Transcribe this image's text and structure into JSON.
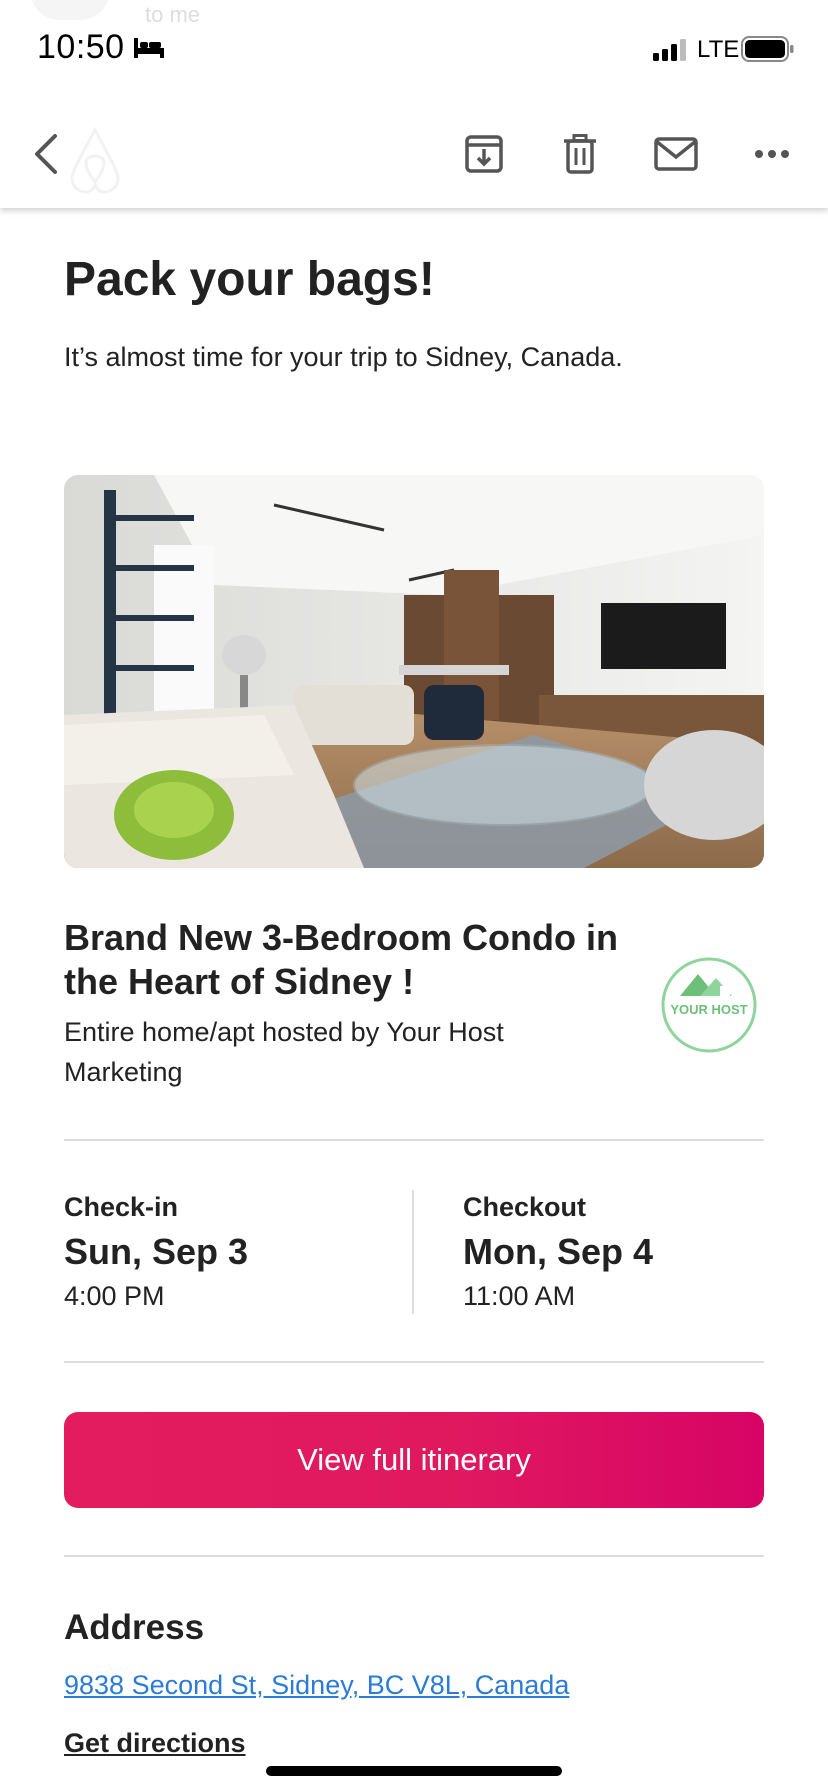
{
  "status_bar": {
    "time": "10:50",
    "network": "LTE",
    "icons": [
      "bed-icon",
      "signal-icon",
      "battery-icon"
    ]
  },
  "ghost_header_text": "to me",
  "toolbar": {
    "icons": [
      "back-icon",
      "archive-icon",
      "trash-icon",
      "mail-icon",
      "more-icon"
    ]
  },
  "email": {
    "headline": "Pack your bags!",
    "subhead": "It’s almost time for your trip to Sidney, Canada.",
    "listing": {
      "title": "Brand New 3-Bedroom Condo in the Heart of Sidney !",
      "subtitle": "Entire home/apt hosted by Your Host Marketing",
      "host_logo_text": "YOUR HOST"
    },
    "checkin": {
      "label": "Check-in",
      "date": "Sun, Sep 3",
      "time": "4:00 PM"
    },
    "checkout": {
      "label": "Checkout",
      "date": "Mon, Sep 4",
      "time": "11:00 AM"
    },
    "cta_label": "View full itinerary",
    "address": {
      "title": "Address",
      "value": "9838 Second St, Sidney, BC V8L, Canada",
      "directions_label": "Get directions"
    }
  },
  "colors": {
    "brand": "#E31C5F",
    "link": "#2A7CD8",
    "text": "#222222",
    "divider": "#DDDDDD"
  }
}
